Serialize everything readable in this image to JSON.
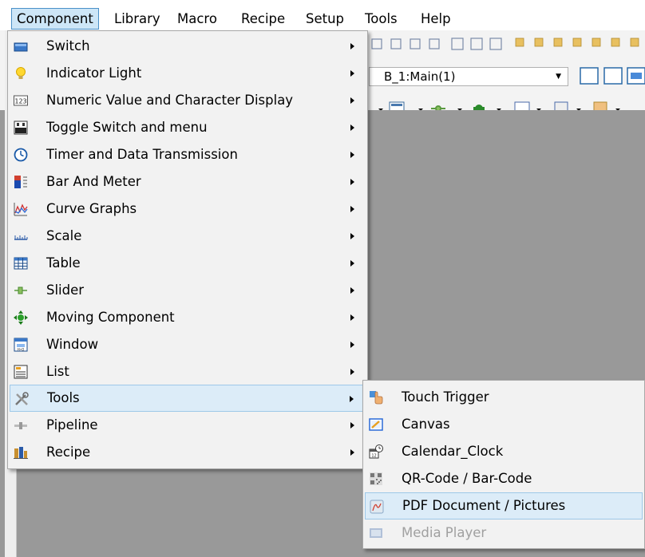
{
  "menubar": {
    "items": [
      {
        "label": "Component",
        "active": true
      },
      {
        "label": "Library"
      },
      {
        "label": "Macro"
      },
      {
        "label": "Recipe"
      },
      {
        "label": "Setup"
      },
      {
        "label": "Tools"
      },
      {
        "label": "Help"
      }
    ]
  },
  "toolbar": {
    "page_select_value": "B_1:Main(1)"
  },
  "component_menu": {
    "items": [
      {
        "label": "Switch",
        "icon": "switch-icon"
      },
      {
        "label": "Indicator Light",
        "icon": "lightbulb-icon"
      },
      {
        "label": "Numeric Value and Character Display",
        "icon": "numeric-123-icon"
      },
      {
        "label": "Toggle Switch and menu",
        "icon": "toggle-switch-icon"
      },
      {
        "label": "Timer and Data Transmission",
        "icon": "clock-icon"
      },
      {
        "label": "Bar And Meter",
        "icon": "bar-meter-icon"
      },
      {
        "label": "Curve Graphs",
        "icon": "curve-graph-icon"
      },
      {
        "label": "Scale",
        "icon": "scale-icon"
      },
      {
        "label": "Table",
        "icon": "table-icon"
      },
      {
        "label": "Slider",
        "icon": "slider-icon"
      },
      {
        "label": "Moving Component",
        "icon": "move-arrows-icon"
      },
      {
        "label": "Window",
        "icon": "window-icon"
      },
      {
        "label": "List",
        "icon": "list-icon"
      },
      {
        "label": "Tools",
        "icon": "tools-icon",
        "highlighted": true
      },
      {
        "label": "Pipeline",
        "icon": "pipeline-icon"
      },
      {
        "label": "Recipe",
        "icon": "recipe-icon"
      }
    ]
  },
  "tools_submenu": {
    "items": [
      {
        "label": "Touch Trigger",
        "icon": "touch-hand-icon"
      },
      {
        "label": "Canvas",
        "icon": "canvas-icon"
      },
      {
        "label": "Calendar_Clock",
        "icon": "calendar-clock-icon"
      },
      {
        "label": "QR-Code / Bar-Code",
        "icon": "qr-code-icon"
      },
      {
        "label": "PDF Document / Pictures",
        "icon": "pdf-document-icon",
        "highlighted": true
      },
      {
        "label": "Media Player",
        "icon": "media-player-icon",
        "disabled": true
      }
    ]
  },
  "colors": {
    "menu_bg": "#f2f2f2",
    "highlight_bg": "#dcecf8",
    "highlight_border": "#9ec8e8",
    "canvas_gray": "#999999",
    "active_menu_border": "#4a90c8"
  }
}
